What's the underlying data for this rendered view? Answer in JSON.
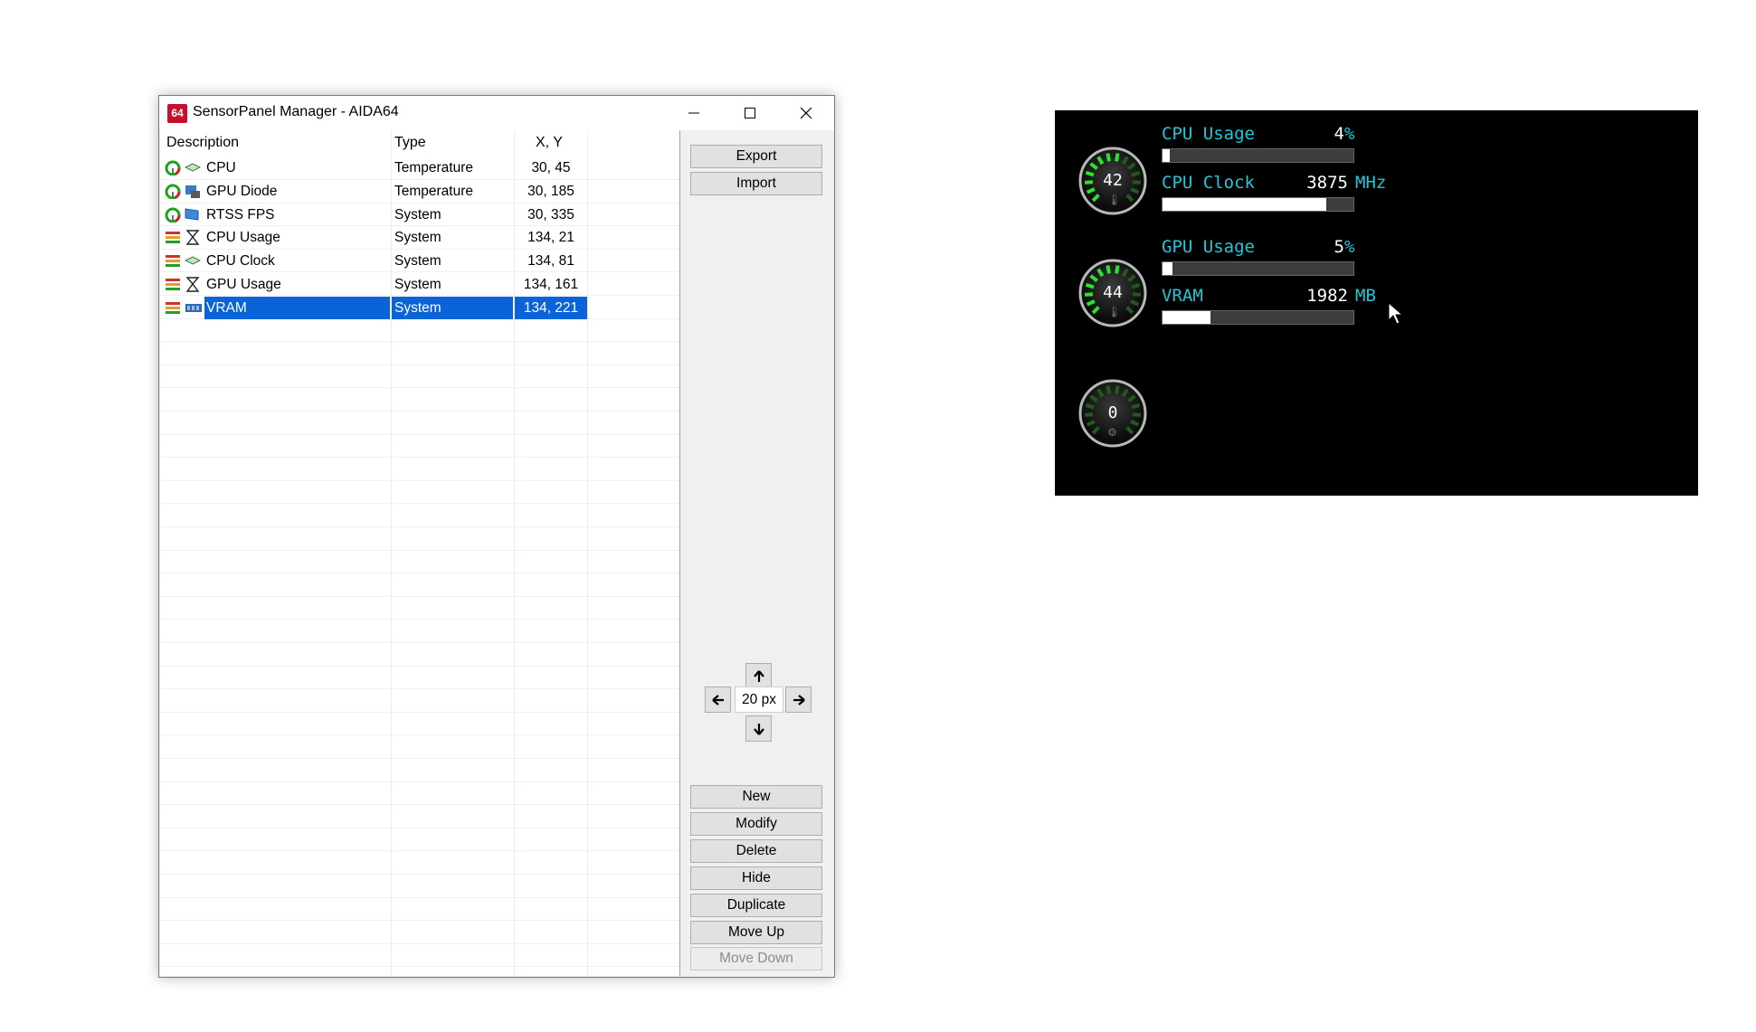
{
  "window": {
    "app_icon_text": "64",
    "title": "SensorPanel Manager - AIDA64"
  },
  "list": {
    "columns": [
      "Description",
      "Type",
      "X, Y"
    ],
    "rows": [
      {
        "description": "CPU",
        "type": "Temperature",
        "xy": "30, 45",
        "icons": [
          "gauge-icon",
          "chip-icon"
        ]
      },
      {
        "description": "GPU Diode",
        "type": "Temperature",
        "xy": "30, 185",
        "icons": [
          "gauge-icon",
          "gpu-icon"
        ]
      },
      {
        "description": "RTSS FPS",
        "type": "System",
        "xy": "30, 335",
        "icons": [
          "gauge-icon",
          "monitor-icon"
        ]
      },
      {
        "description": "CPU Usage",
        "type": "System",
        "xy": "134, 21",
        "icons": [
          "bar-icon",
          "hourglass-icon"
        ]
      },
      {
        "description": "CPU Clock",
        "type": "System",
        "xy": "134, 81",
        "icons": [
          "bar-icon",
          "chip-icon"
        ]
      },
      {
        "description": "GPU Usage",
        "type": "System",
        "xy": "134, 161",
        "icons": [
          "bar-icon",
          "hourglass-icon"
        ]
      },
      {
        "description": "VRAM",
        "type": "System",
        "xy": "134, 221",
        "icons": [
          "bar-icon",
          "memory-icon"
        ],
        "selected": true
      }
    ]
  },
  "buttons": {
    "export": "Export",
    "import": "Import",
    "step": "20 px",
    "new": "New",
    "modify": "Modify",
    "delete": "Delete",
    "hide": "Hide",
    "duplicate": "Duplicate",
    "move_up": "Move Up",
    "move_down": "Move Down"
  },
  "sensorpanel": {
    "gauges": [
      {
        "value": "42",
        "icon": "thermometer-icon"
      },
      {
        "value": "44",
        "icon": "thermometer-icon"
      },
      {
        "value": "0",
        "icon": "gear-icon"
      }
    ],
    "bars": [
      {
        "label": "CPU Usage",
        "value": "4",
        "unit": "%",
        "fraction": 0.04
      },
      {
        "label": "CPU Clock",
        "value": "3875",
        "unit": "MHz",
        "fraction": 0.86
      },
      {
        "label": "GPU Usage",
        "value": "5",
        "unit": "%",
        "fraction": 0.05
      },
      {
        "label": "VRAM",
        "value": "1982",
        "unit": "MB",
        "fraction": 0.25
      }
    ],
    "colors": {
      "label": "#1ec8d8",
      "gauge_active": "#2ee02e",
      "background": "#000000"
    }
  }
}
